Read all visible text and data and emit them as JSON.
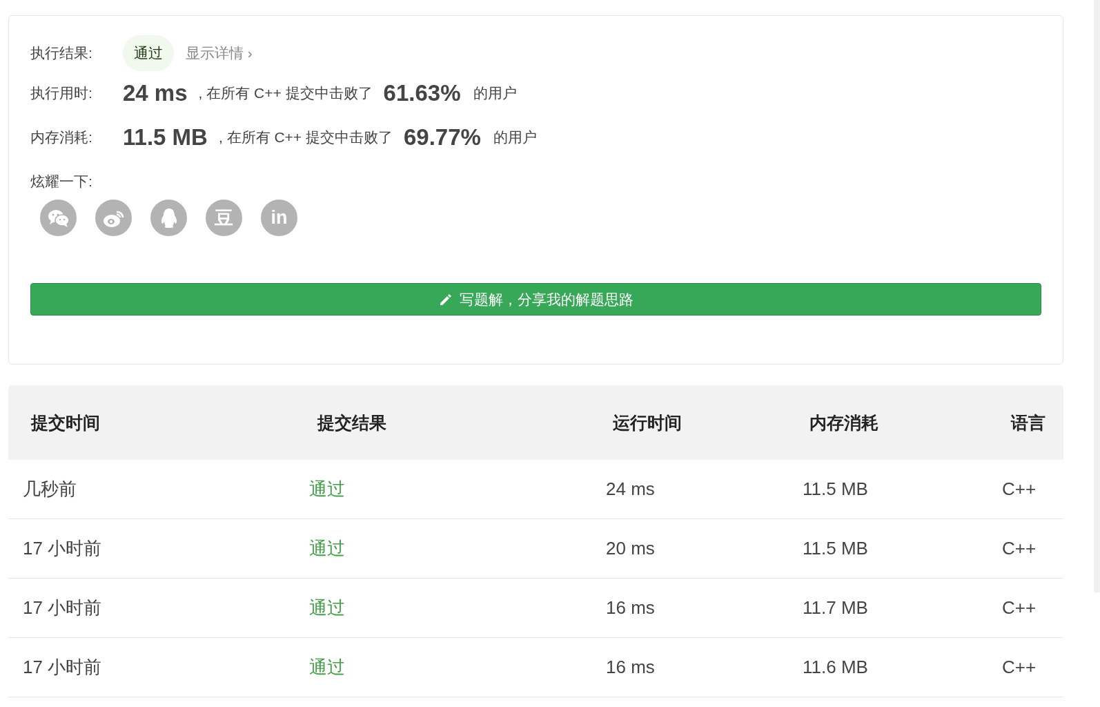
{
  "result_card": {
    "result": {
      "label": "执行结果:",
      "badge": "通过",
      "details_link": "显示详情 ›"
    },
    "stats": [
      {
        "label": "执行用时:",
        "value": "24 ms",
        "text": ", 在所有 C++ 提交中击败了",
        "percent": "61.63%",
        "suffix": "的用户"
      },
      {
        "label": "内存消耗:",
        "value": "11.5 MB",
        "text": ", 在所有 C++ 提交中击败了",
        "percent": "69.77%",
        "suffix": "的用户"
      }
    ],
    "share": {
      "label": "炫耀一下:",
      "buttons": [
        {
          "kind": "chat"
        },
        {
          "kind": "eye"
        },
        {
          "kind": "penguin"
        },
        {
          "kind": "glyph",
          "glyph": "豆"
        },
        {
          "kind": "glyph",
          "glyph": "in"
        }
      ]
    },
    "write_button": "写题解，分享我的解题思路"
  },
  "table": {
    "columns": [
      "提交时间",
      "提交结果",
      "运行时间",
      "内存消耗",
      "语言"
    ],
    "rows": [
      {
        "time": "几秒前",
        "result": "通过",
        "kind": "accepted",
        "runtime": "24 ms",
        "memory": "11.5 MB",
        "language": "C++"
      },
      {
        "time": "17 小时前",
        "result": "通过",
        "kind": "accepted",
        "runtime": "20 ms",
        "memory": "11.5 MB",
        "language": "C++"
      },
      {
        "time": "17 小时前",
        "result": "通过",
        "kind": "accepted",
        "runtime": "16 ms",
        "memory": "11.7 MB",
        "language": "C++"
      },
      {
        "time": "17 小时前",
        "result": "通过",
        "kind": "accepted",
        "runtime": "16 ms",
        "memory": "11.6 MB",
        "language": "C++"
      }
    ]
  }
}
